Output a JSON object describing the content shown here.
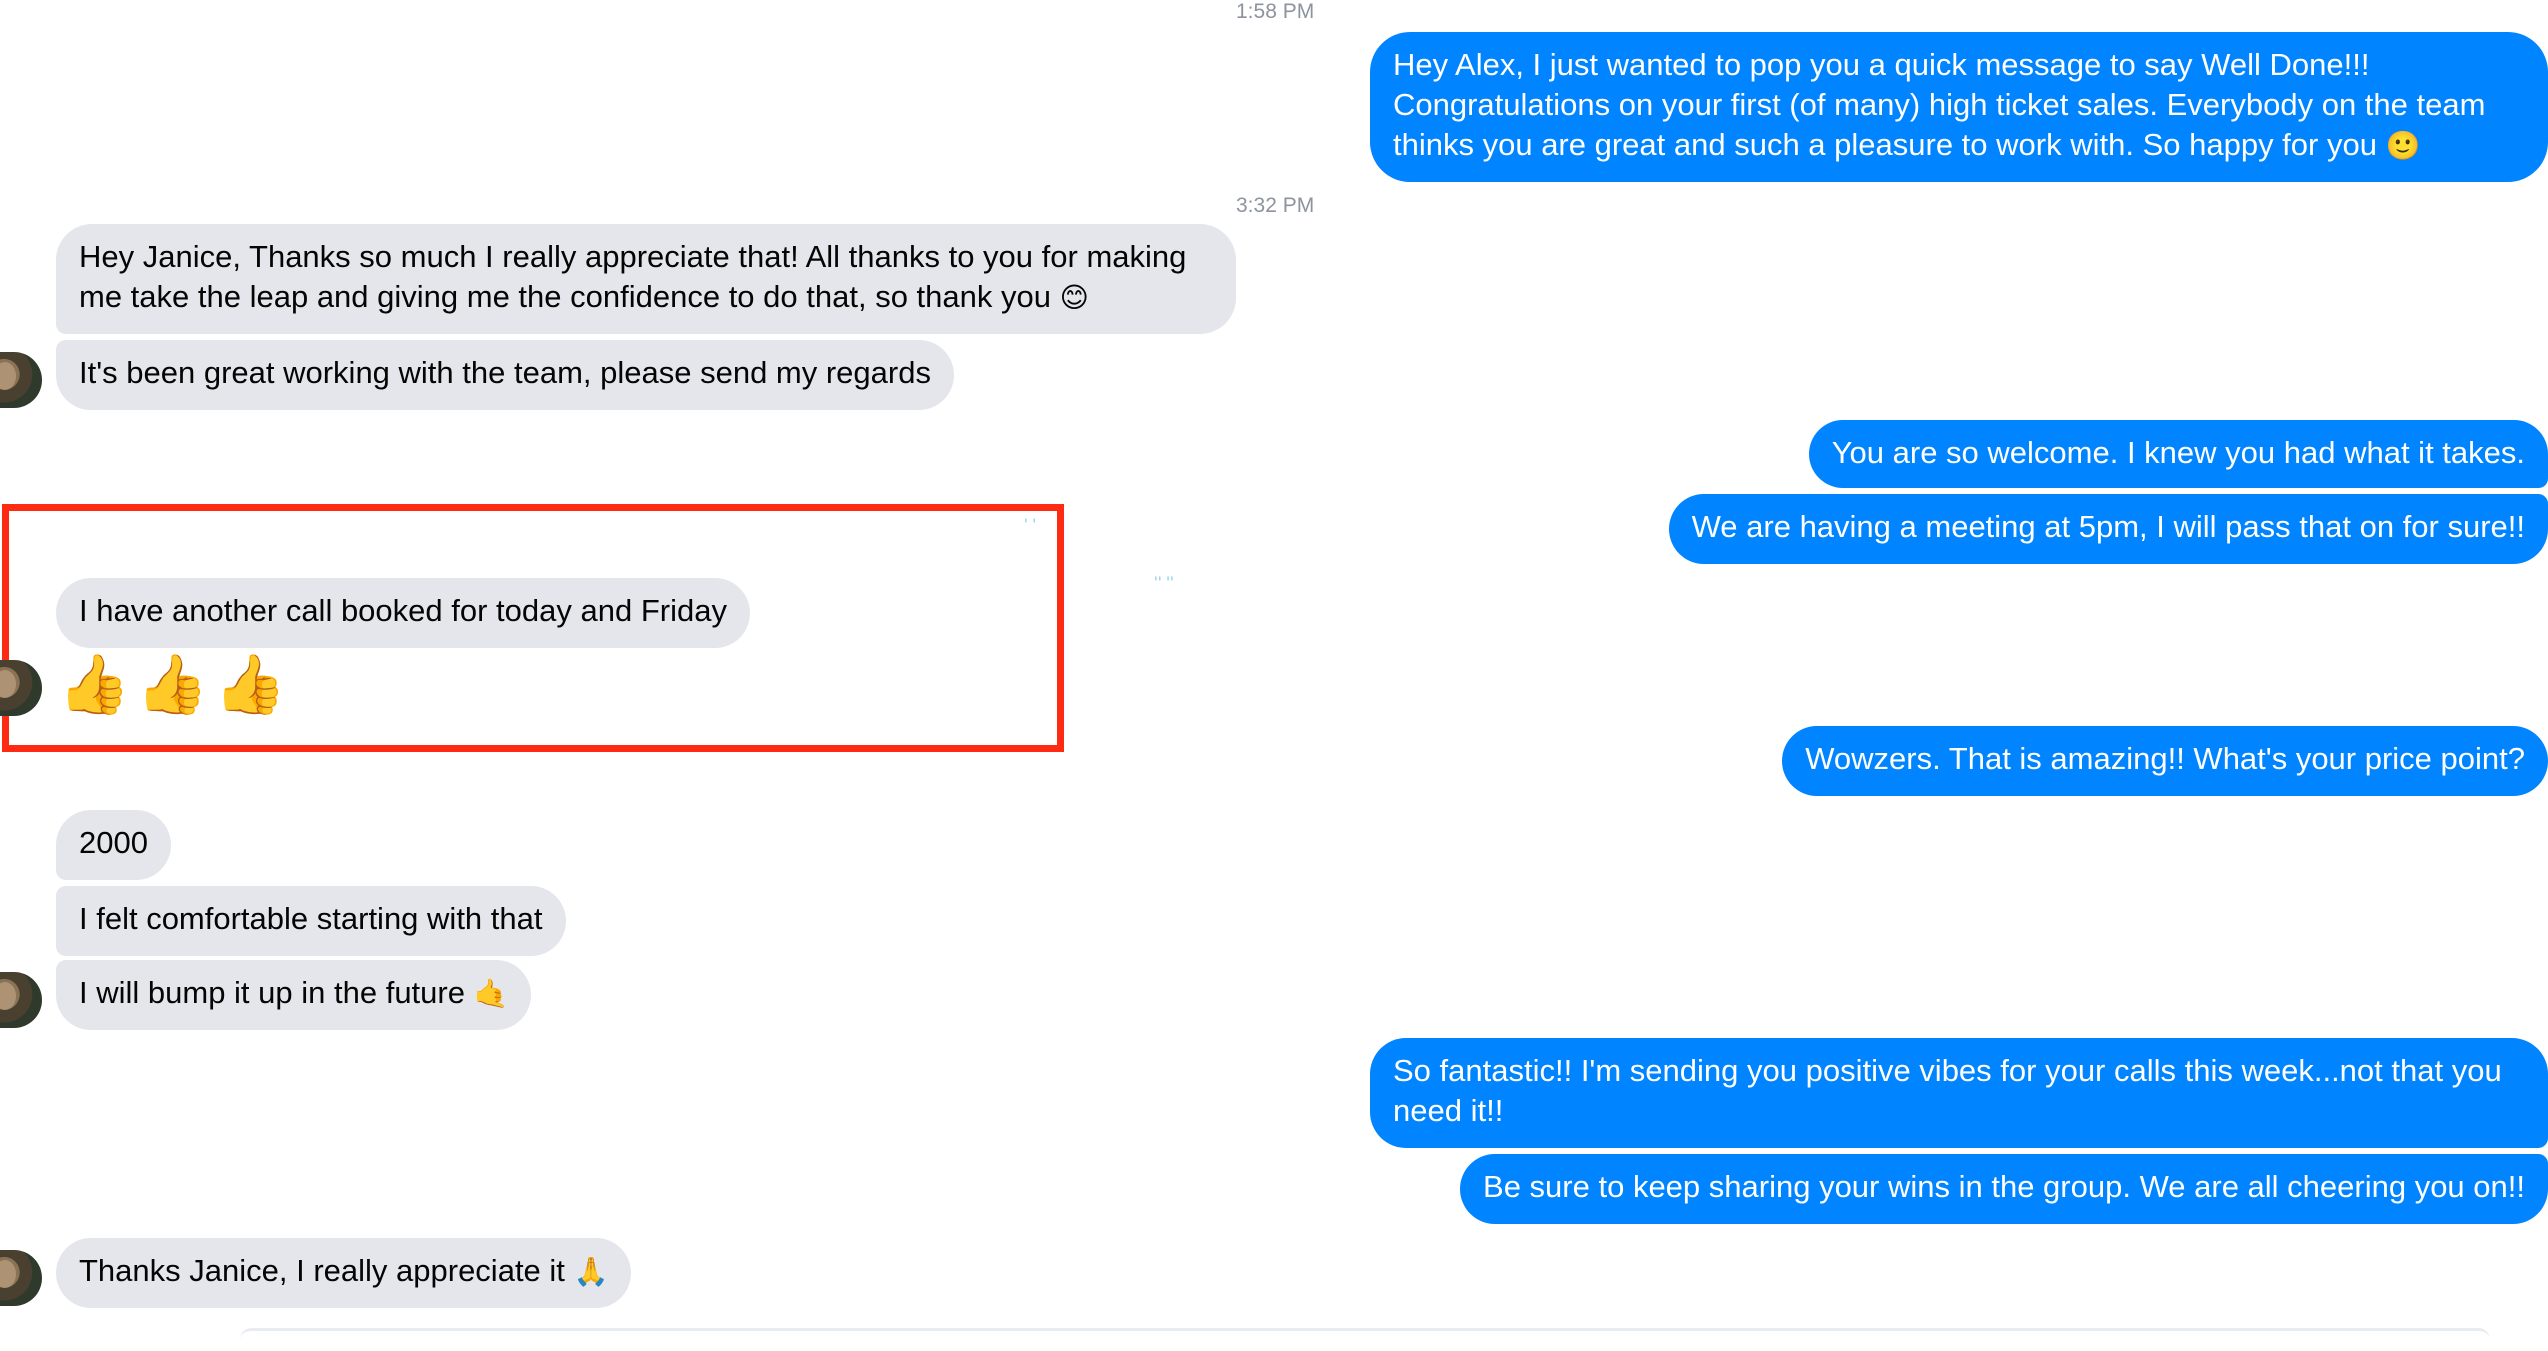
{
  "timestamps": [
    "1:58 PM",
    "3:32 PM"
  ],
  "messages": [
    {
      "from": "me",
      "lines": [
        "Hey Alex, I just wanted to pop you a quick message to say Well Done!!!",
        "Congratulations on your first (of many) high ticket sales.  Everybody on the team",
        "thinks you are great and such a pleasure to work with.  So happy for you"
      ],
      "emoji": "🙂"
    },
    {
      "from": "them",
      "lines": [
        "Hey Janice, Thanks so much I really appreciate that! All thanks to you for making",
        "me take the leap and giving me the confidence to do that, so thank you"
      ],
      "emoji": "😊"
    },
    {
      "from": "them",
      "text": "It's been great working with the team, please send my regards"
    },
    {
      "from": "me",
      "text": "You are so welcome.  I knew you had what it takes."
    },
    {
      "from": "me",
      "text": "We are having a meeting at 5pm, I will pass that on for sure!!"
    },
    {
      "from": "them",
      "text": "I have another call booked for today and Friday"
    },
    {
      "from": "them",
      "text": "👍👍👍"
    },
    {
      "from": "me",
      "text": "Wowzers. That is amazing!!  What's your price point?"
    },
    {
      "from": "them",
      "text": "2000"
    },
    {
      "from": "them",
      "text": "I felt comfortable starting with that"
    },
    {
      "from": "them",
      "text": "I will bump it up in the future",
      "emoji": "🤙"
    },
    {
      "from": "me",
      "lines": [
        "So fantastic!!  I'm sending you positive vibes for your calls this week...not that you",
        "need it!!"
      ]
    },
    {
      "from": "me",
      "text": "Be sure to keep sharing your wins in the group.  We are all cheering you on!!"
    },
    {
      "from": "them",
      "text": "Thanks Janice, I really appreciate it",
      "emoji": "🙏"
    }
  ],
  "colors": {
    "outgoing": "#0084ff",
    "incoming": "#e4e6eb",
    "highlight": "#ff2a12",
    "timestamp": "#8d949e"
  },
  "icons": {
    "avatar": "contact-avatar-photo"
  }
}
